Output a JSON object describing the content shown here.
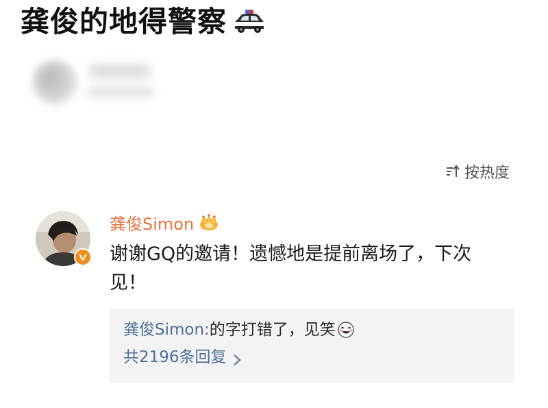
{
  "post": {
    "headline": "龚俊的地得警察",
    "headline_emoji": "police-car-icon"
  },
  "sort": {
    "label": "按热度",
    "icon": "sort-icon"
  },
  "comment": {
    "author": "龚俊Simon",
    "author_badge": "crown-icon",
    "verified_badge": "verified-v-icon",
    "text": "谢谢GQ的邀请！遗憾地是提前离场了，下次见！",
    "reply": {
      "author": "龚俊Simon:",
      "text": " 的字打错了，见笑",
      "emoji": "laugh-emoji",
      "count_label": "共2196条回复"
    }
  },
  "colors": {
    "author_orange": "#e8733a",
    "link_blue": "#4e6f9a",
    "reply_bg": "#f3f3f3",
    "badge_orange": "#f08c1c"
  }
}
